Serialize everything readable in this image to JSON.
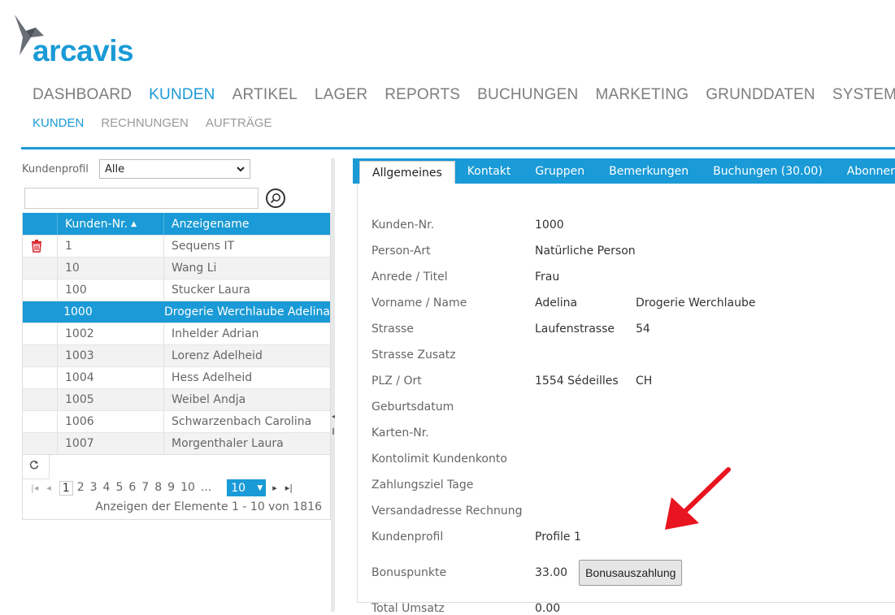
{
  "logo": {
    "text": "arcavis"
  },
  "main_nav": [
    "DASHBOARD",
    "KUNDEN",
    "ARTIKEL",
    "LAGER",
    "REPORTS",
    "BUCHUNGEN",
    "MARKETING",
    "GRUNDDATEN",
    "SYSTEM"
  ],
  "main_nav_active": "KUNDEN",
  "sub_nav": [
    "KUNDEN",
    "RECHNUNGEN",
    "AUFTRÄGE"
  ],
  "filter": {
    "label": "Kundenprofil",
    "value": "Alle"
  },
  "grid": {
    "columns": [
      "Kunden-Nr.",
      "Anzeigename"
    ],
    "rows": [
      {
        "nr": "1",
        "name": "Sequens IT"
      },
      {
        "nr": "10",
        "name": "Wang Li"
      },
      {
        "nr": "100",
        "name": "Stucker Laura"
      },
      {
        "nr": "1000",
        "name": "Drogerie Werchlaube Adelina"
      },
      {
        "nr": "1002",
        "name": "Inhelder Adrian"
      },
      {
        "nr": "1003",
        "name": "Lorenz Adelheid"
      },
      {
        "nr": "1004",
        "name": "Hess Adelheid"
      },
      {
        "nr": "1005",
        "name": "Weibel Andja"
      },
      {
        "nr": "1006",
        "name": "Schwarzenbach Carolina"
      },
      {
        "nr": "1007",
        "name": "Morgenthaler Laura"
      }
    ],
    "selected_index": 3
  },
  "pager": {
    "pages": [
      "1",
      "2",
      "3",
      "4",
      "5",
      "6",
      "7",
      "8",
      "9",
      "10",
      "..."
    ],
    "page_size": "10",
    "info": "Anzeigen der Elemente 1 - 10 von 1816"
  },
  "tabs": [
    "Allgemeines",
    "Kontakt",
    "Gruppen",
    "Bemerkungen",
    "Buchungen (30.00)",
    "Abonnemente"
  ],
  "details": {
    "kunden_nr": {
      "label": "Kunden-Nr.",
      "value": "1000"
    },
    "person_art": {
      "label": "Person-Art",
      "value": "Natürliche Person"
    },
    "anrede": {
      "label": "Anrede / Titel",
      "value": "Frau"
    },
    "name": {
      "label": "Vorname / Name",
      "value": "Adelina",
      "value2": "Drogerie Werchlaube"
    },
    "strasse": {
      "label": "Strasse",
      "value": "Laufenstrasse",
      "value2": "54"
    },
    "strasse_zusatz": {
      "label": "Strasse Zusatz"
    },
    "plz_ort": {
      "label": "PLZ / Ort",
      "value": "1554 Sédeilles",
      "value2": "CH"
    },
    "geburtsdatum": {
      "label": "Geburtsdatum"
    },
    "karten_nr": {
      "label": "Karten-Nr."
    },
    "kontolimit": {
      "label": "Kontolimit Kundenkonto"
    },
    "zahlungsziel": {
      "label": "Zahlungsziel Tage"
    },
    "versandadresse": {
      "label": "Versandadresse Rechnung"
    },
    "kundenprofil": {
      "label": "Kundenprofil",
      "value": "Profile 1"
    },
    "bonuspunkte": {
      "label": "Bonuspunkte",
      "value": "33.00",
      "button": "Bonusauszahlung"
    },
    "total_umsatz": {
      "label": "Total Umsatz",
      "value": "0.00"
    }
  },
  "colors": {
    "accent": "#1a9ad6",
    "delete": "#d9232e",
    "arrow": "#e8141f"
  }
}
